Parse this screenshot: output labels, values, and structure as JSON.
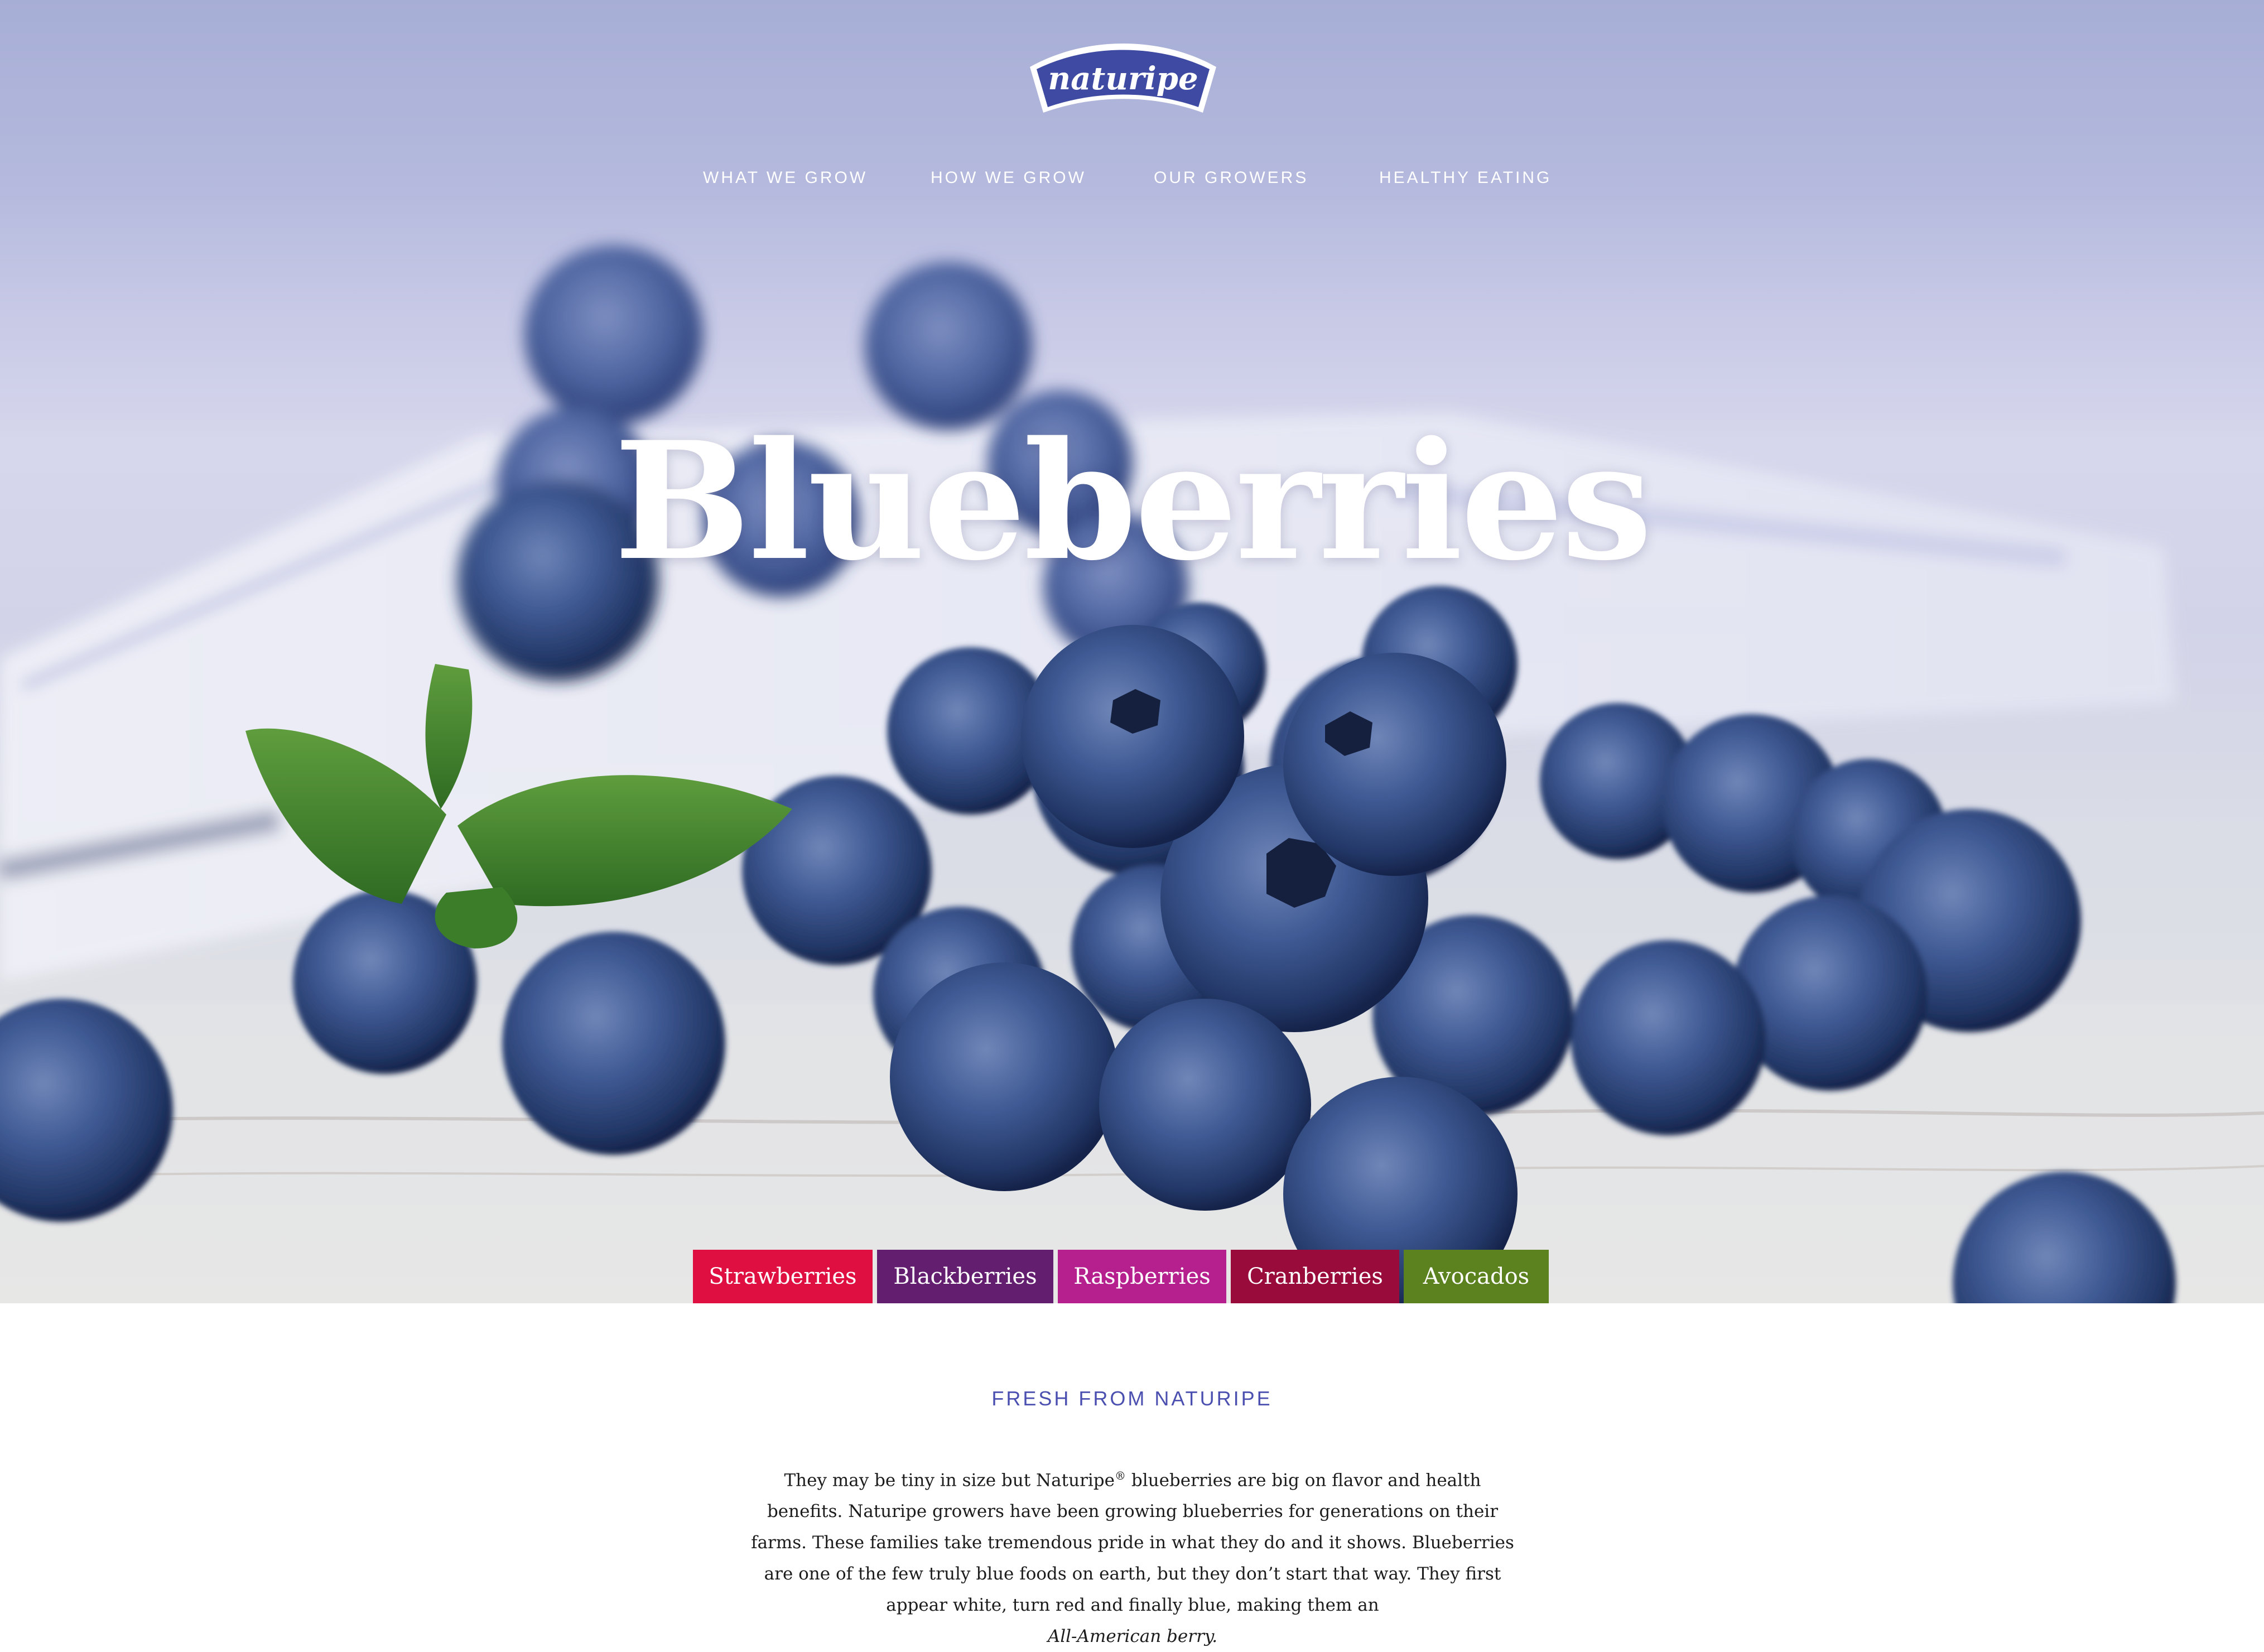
{
  "brand": {
    "logo_text": "naturipe",
    "logo_color": "#3f4aa3"
  },
  "nav": {
    "items": [
      {
        "label": "WHAT WE GROW"
      },
      {
        "label": "HOW WE GROW"
      },
      {
        "label": "OUR GROWERS"
      },
      {
        "label": "HEALTHY EATING"
      }
    ]
  },
  "hero": {
    "title": "Blueberries"
  },
  "berry_tabs": [
    {
      "label": "Strawberries",
      "color": "#df1041"
    },
    {
      "label": "Blackberries",
      "color": "#641e70"
    },
    {
      "label": "Raspberries",
      "color": "#b5208e"
    },
    {
      "label": "Cranberries",
      "color": "#990b3a"
    },
    {
      "label": "Avocados",
      "color": "#5b821e"
    }
  ],
  "intro": {
    "heading": "FRESH FROM NATURIPE",
    "body_part1": "They may be tiny in size but Naturipe",
    "registered_mark": "®",
    "body_part2": " blueberries are big on flavor and health benefits. Naturipe growers have been growing blueberries for generations on their farms. These families take tremendous pride in what they do and it shows. Blueberries are one of the few truly blue foods on earth, but they don’t start that way. They first appear white, turn red and finally blue, making them an",
    "body_emphasis": "All-American berry."
  }
}
